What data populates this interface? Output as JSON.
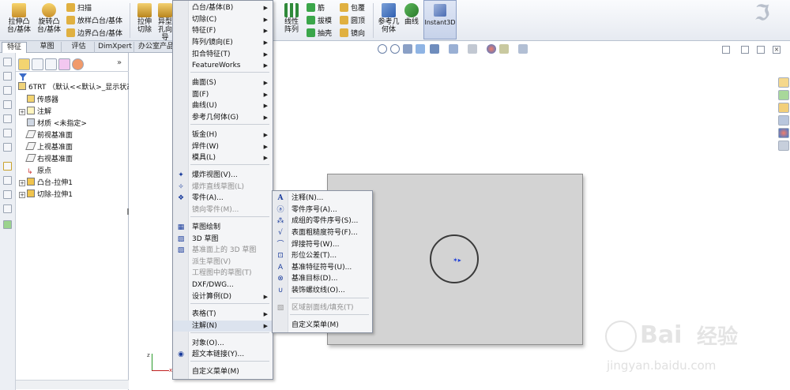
{
  "ribbon": {
    "boss_extrude": "拉伸凸台/基体",
    "revolve_boss": "旋转凸台/基体",
    "sweep": "扫描",
    "loft_boss": "放样凸台/基体",
    "boundary_boss": "边界凸台/基体",
    "cut_extrude": "拉伸切除",
    "other_cut": "异型孔向导",
    "linear_pattern": "线性阵列",
    "rib": "筋",
    "draft": "拔模",
    "shell": "抽壳",
    "wrap": "包覆",
    "dome": "圆顶",
    "mirror": "镜向",
    "reference_geometry": "参考几何体",
    "curves": "曲线",
    "instant3d": "Instant3D"
  },
  "tabs": [
    "特征",
    "草图",
    "评估",
    "DimXpert",
    "办公室产品"
  ],
  "tree": {
    "root": "6TRT （默认<<默认>_显示状态",
    "items": [
      "传感器",
      "注解",
      "材质 <未指定>",
      "前视基准面",
      "上视基准面",
      "右视基准面",
      "原点",
      "凸台-拉伸1",
      "切除-拉伸1"
    ]
  },
  "main_menu": {
    "items": [
      {
        "label": "凸台/基体(B)",
        "arrow": "▶"
      },
      {
        "label": "切除(C)",
        "arrow": "▶"
      },
      {
        "label": "特征(F)",
        "arrow": "▶"
      },
      {
        "label": "阵列/镜向(E)",
        "arrow": "▶"
      },
      {
        "label": "扣合特征(T)",
        "arrow": "▶"
      },
      {
        "label": "FeatureWorks",
        "arrow": "▶"
      },
      {
        "label": "曲面(S)",
        "arrow": "▶"
      },
      {
        "label": "面(F)",
        "arrow": "▶"
      },
      {
        "label": "曲线(U)",
        "arrow": "▶"
      },
      {
        "label": "参考几何体(G)",
        "arrow": "▶"
      },
      {
        "label": "钣金(H)",
        "arrow": "▶"
      },
      {
        "label": "焊件(W)",
        "arrow": "▶"
      },
      {
        "label": "模具(L)",
        "arrow": "▶"
      },
      {
        "label": "爆炸视图(V)...",
        "arrow": ""
      },
      {
        "label": "爆炸直线草图(L)",
        "arrow": ""
      },
      {
        "label": "零件(A)...",
        "arrow": ""
      },
      {
        "label": "镜向零件(M)...",
        "arrow": ""
      },
      {
        "label": "草图绘制",
        "arrow": ""
      },
      {
        "label": "3D 草图",
        "arrow": ""
      },
      {
        "label": "基准面上的 3D 草图",
        "arrow": ""
      },
      {
        "label": "派生草图(V)",
        "arrow": ""
      },
      {
        "label": "工程图中的草图(T)",
        "arrow": ""
      },
      {
        "label": "DXF/DWG...",
        "arrow": ""
      },
      {
        "label": "设计算例(D)",
        "arrow": "▶"
      },
      {
        "label": "表格(T)",
        "arrow": "▶"
      },
      {
        "label": "注解(N)",
        "arrow": "▶"
      },
      {
        "label": "对象(O)...",
        "arrow": ""
      },
      {
        "label": "超文本链接(Y)...",
        "arrow": ""
      },
      {
        "label": "自定义菜单(M)",
        "arrow": ""
      }
    ]
  },
  "annotation_menu": {
    "items": [
      {
        "label": "注释(N)...",
        "icon": "A"
      },
      {
        "label": "零件序号(A)...",
        "icon": "ⓐ"
      },
      {
        "label": "成组的零件序号(S)...",
        "icon": "⁂"
      },
      {
        "label": "表面粗糙度符号(F)...",
        "icon": "√"
      },
      {
        "label": "焊接符号(W)...",
        "icon": "⌒"
      },
      {
        "label": "形位公差(T)...",
        "icon": "⊡"
      },
      {
        "label": "基准特征符号(U)...",
        "icon": "A"
      },
      {
        "label": "基准目标(D)...",
        "icon": "⊗"
      },
      {
        "label": "装饰螺纹线(O)...",
        "icon": "∪"
      },
      {
        "label": "区域剖面线/填充(T)",
        "icon": "▧"
      },
      {
        "label": "自定义菜单(M)",
        "icon": ""
      }
    ]
  },
  "watermark": {
    "brand": "Bai",
    "brand_cn": "经验",
    "url": "jingyan.baidu.com"
  },
  "colors": {
    "accent": "#1a3c9c",
    "ribbon_bg": "#e6eaf1",
    "sheet": "#d3d3d3"
  }
}
